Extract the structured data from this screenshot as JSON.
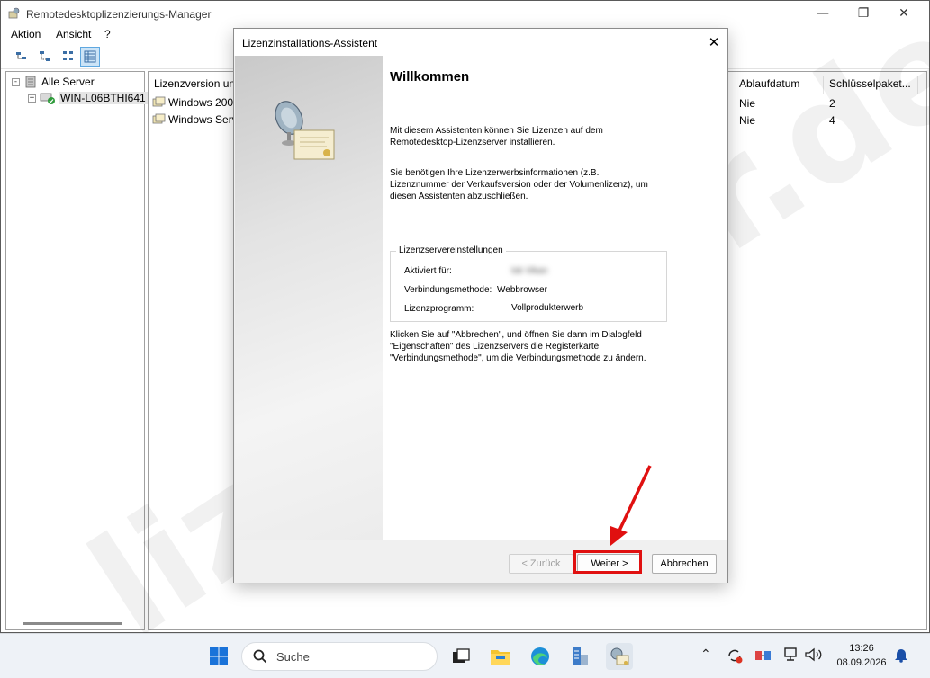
{
  "window": {
    "title": "Remotedesktoplizenzierungs-Manager",
    "minimize_glyph": "—",
    "restore_glyph": "❐",
    "close_glyph": "✕"
  },
  "menu": [
    "Aktion",
    "Ansicht",
    "?"
  ],
  "toolbar": {
    "buttons": [
      "tree-view-icon",
      "connect-icon",
      "refresh-icon",
      "details-view-icon"
    ]
  },
  "tree": {
    "root": {
      "label": "Alle Server",
      "expander": "-"
    },
    "server": {
      "label": "WIN-L06BTHI641",
      "expander": "+"
    }
  },
  "list": {
    "columns": [
      "Lizenzversion und",
      "Ablaufdatum",
      "Schlüsselpaket..."
    ],
    "rows": [
      {
        "name": "Windows 2000",
        "expiry": "Nie",
        "count": "2"
      },
      {
        "name": "Windows Serv",
        "expiry": "Nie",
        "count": "4"
      }
    ]
  },
  "watermark": "lizenzstar.de",
  "wizard": {
    "title": "Lizenzinstallations-Assistent",
    "close_glyph": "✕",
    "heading": "Willkommen",
    "intro": "Mit diesem Assistenten können Sie Lizenzen auf dem Remotedesktop-Lizenzserver installieren.",
    "info": "Sie benötigen Ihre Lizenzerwerbsinformationen (z.B. Lizenznummer der Verkaufsversion oder der Volumenlizenz), um diesen Assistenten abzuschließen.",
    "settings": {
      "legend": "Lizenzservereinstellungen",
      "activated_label": "Aktiviert für:",
      "activated_value": "lok Vikan",
      "method_label": "Verbindungsmethode:",
      "method_value": "Webbrowser",
      "program_label": "Lizenzprogramm:",
      "program_value": "Vollprodukterwerb"
    },
    "hint": "Klicken Sie auf \"Abbrechen\", und öffnen Sie dann im Dialogfeld \"Eigenschaften\" des Lizenzservers die Registerkarte \"Verbindungsmethode\", um die Verbindungsmethode zu ändern.",
    "buttons": {
      "back": "< Zurück",
      "next": "Weiter >",
      "cancel": "Abbrechen"
    }
  },
  "taskbar": {
    "search_label": "Suche",
    "time": "13:26",
    "date": "08.09.2026",
    "apps": [
      "windows-start-icon",
      "task-view-icon",
      "file-explorer-icon",
      "edge-icon",
      "server-manager-icon",
      "license-manager-icon"
    ]
  },
  "colors": {
    "highlight": "#e01010",
    "accent": "#0078d4"
  }
}
